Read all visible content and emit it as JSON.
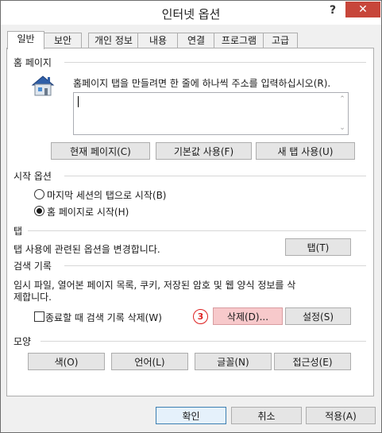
{
  "window": {
    "title": "인터넷 옵션",
    "help_label": "?",
    "close_label": "✕"
  },
  "tabs": [
    {
      "label": "일반",
      "active": true
    },
    {
      "label": "보안"
    },
    {
      "label": "개인 정보"
    },
    {
      "label": "내용"
    },
    {
      "label": "연결"
    },
    {
      "label": "프로그램"
    },
    {
      "label": "고급"
    }
  ],
  "homepage": {
    "section_title": "홈 페이지",
    "description": "홈페이지 탭을 만들려면 한 줄에 하나씩 주소를 입력하십시오(R).",
    "textarea_value": "",
    "icon": "house-icon",
    "buttons": {
      "use_current": "현재 페이지(C)",
      "use_default": "기본값 사용(F)",
      "use_new_tab": "새 탭 사용(U)"
    }
  },
  "startup": {
    "section_title": "시작 옵션",
    "option_last_session": "마지막 세션의 탭으로 시작(B)",
    "option_homepage": "홈 페이지로 시작(H)",
    "selected": "option_homepage"
  },
  "tabs_section": {
    "section_title": "탭",
    "description": "탭 사용에 관련된 옵션을 변경합니다.",
    "button": "탭(T)"
  },
  "history": {
    "section_title": "검색 기록",
    "description_line1": "임시 파일, 열어본 페이지 목록, 쿠키, 저장된 암호 및 웹 양식 정보를 삭",
    "description_line2": "제합니다.",
    "checkbox_label": "종료할 때 검색 기록 삭제(W)",
    "checkbox_checked": false,
    "step_marker": "3",
    "delete_button": "삭제(D)...",
    "settings_button": "설정(S)",
    "highlight_color": "#f7c9cb",
    "marker_color": "#dd2222"
  },
  "appearance": {
    "section_title": "모양",
    "colors_button": "색(O)",
    "languages_button": "언어(L)",
    "fonts_button": "글꼴(N)",
    "accessibility_button": "접근성(E)"
  },
  "footer": {
    "ok": "확인",
    "cancel": "취소",
    "apply": "적용(A)"
  }
}
